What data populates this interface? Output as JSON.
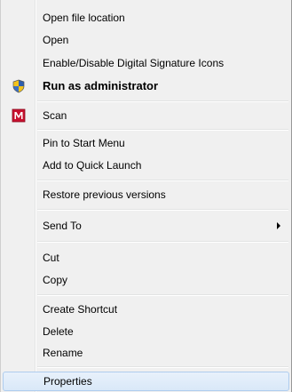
{
  "menu": {
    "items": {
      "open_file_location": {
        "label": "Open file location"
      },
      "open": {
        "label": "Open"
      },
      "enable_disable_sig": {
        "label": "Enable/Disable Digital Signature Icons"
      },
      "run_as_admin": {
        "label": "Run as administrator",
        "icon": "uac-shield-icon"
      },
      "scan": {
        "label": "Scan",
        "icon": "mcafee-m-icon"
      },
      "pin_start": {
        "label": "Pin to Start Menu"
      },
      "add_quick_launch": {
        "label": "Add to Quick Launch"
      },
      "restore_prev": {
        "label": "Restore previous versions"
      },
      "send_to": {
        "label": "Send To",
        "has_submenu": true
      },
      "cut": {
        "label": "Cut"
      },
      "copy": {
        "label": "Copy"
      },
      "create_shortcut": {
        "label": "Create Shortcut"
      },
      "delete": {
        "label": "Delete"
      },
      "rename": {
        "label": "Rename"
      },
      "properties": {
        "label": "Properties",
        "state": "hover"
      }
    },
    "colors": {
      "background": "#f0f0f0",
      "hover_border": "#aeccee",
      "brand_red": "#c8102e"
    }
  }
}
